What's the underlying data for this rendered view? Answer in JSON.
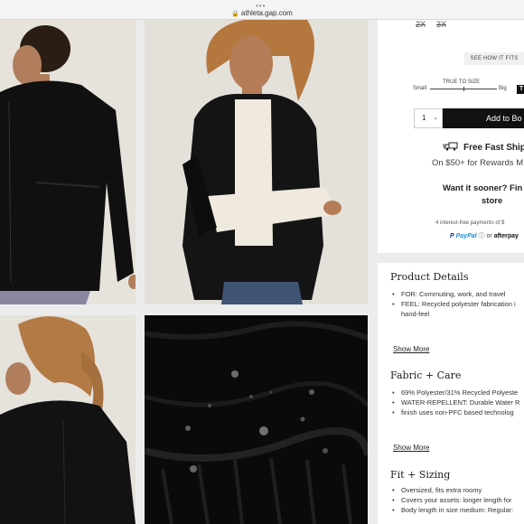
{
  "browser": {
    "url": "athleta.gap.com",
    "menu_dots": "•••"
  },
  "colors": {
    "accent": "#111111",
    "paypal_dark": "#0a3a8a",
    "paypal_light": "#1c8fd3"
  },
  "product": {
    "sizes_unavailable": [
      "2X",
      "3X"
    ],
    "see_how_it_fits": "SEE HOW IT FITS",
    "fit_scale": {
      "title": "TRUE TO SIZE",
      "small": "Small",
      "big": "Big",
      "level": 0.5
    },
    "quantity": "1",
    "add_to_bag": "Add to Bo",
    "shipping": {
      "title": "Free Fast Ship",
      "subtitle": "On $50+ for Rewards M"
    },
    "pickup": {
      "line1": "Want it sooner? Fin",
      "line2": "store"
    },
    "payments": {
      "text": "4 interest-free payments of $",
      "paypal": "PayPal",
      "or": "or",
      "afterpay": "afterpay"
    }
  },
  "sections": {
    "details": {
      "title": "Product Details",
      "bullets": [
        "FOR: Commuting, work, and travel",
        "FEEL: Recycled polyester fabrication i",
        "hand-feel"
      ],
      "show_more": "Show More"
    },
    "fabric": {
      "title": "Fabric + Care",
      "bullets": [
        "69% Polyester/31% Recycled Polyeste",
        "WATER-REPELLENT: Durable Water R",
        "finish uses non-PFC based technolog"
      ],
      "show_more": "Show More"
    },
    "fit": {
      "title": "Fit + Sizing",
      "bullets": [
        "Oversized, fits extra roomy",
        "Covers your assets: longer length for",
        "Body length in size medium: Regular:"
      ]
    }
  }
}
